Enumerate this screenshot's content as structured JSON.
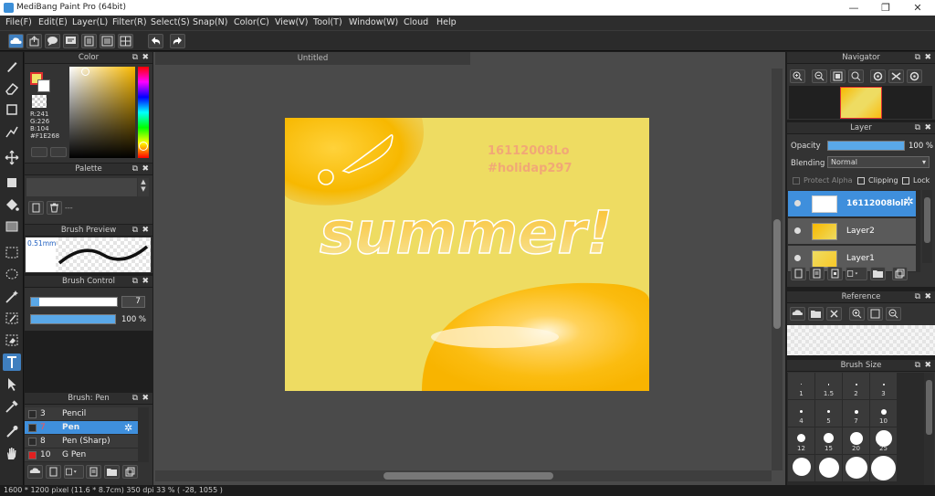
{
  "window": {
    "title": "MediBang Paint Pro (64bit)",
    "min": "—",
    "max": "❐",
    "close": "✕"
  },
  "menu": [
    "File(F)",
    "Edit(E)",
    "Layer(L)",
    "Filter(R)",
    "Select(S)",
    "Snap(N)",
    "Color(C)",
    "View(V)",
    "Tool(T)",
    "Window(W)",
    "Cloud",
    "Help"
  ],
  "color_panel": {
    "title": "Color",
    "rgb_r": "R:241",
    "rgb_g": "G:226",
    "rgb_b": "B:104",
    "hex": "#F1E268"
  },
  "palette_panel": {
    "title": "Palette",
    "empty": "---"
  },
  "brush_preview": {
    "title": "Brush Preview",
    "size": "0.51mm"
  },
  "brush_control": {
    "title": "Brush Control",
    "size_value": "7",
    "opacity_value": "100 %",
    "size_fill": 0.1,
    "opacity_fill": 1.0
  },
  "brush_list": {
    "title": "Brush: Pen",
    "items": [
      {
        "num": "3",
        "name": "Pencil",
        "color": "#2a2a2a"
      },
      {
        "num": "7",
        "name": "Pen",
        "color": "#2a2a2a"
      },
      {
        "num": "8",
        "name": "Pen (Sharp)",
        "color": "#2a2a2a"
      },
      {
        "num": "10",
        "name": "G Pen",
        "color": "#e02020"
      }
    ]
  },
  "document": {
    "tab": "Untitled",
    "text_line1": "16112008Lo",
    "text_line2": "#holidap297",
    "word": "summer!"
  },
  "navigator": {
    "title": "Navigator"
  },
  "layer_panel": {
    "title": "Layer",
    "opacity_label": "Opacity",
    "opacity_value": "100 %",
    "opacity_fill": 1.0,
    "blending_label": "Blending",
    "blending_value": "Normal",
    "protect_alpha": "Protect Alpha",
    "clipping": "Clipping",
    "lock": "Lock",
    "layers": [
      {
        "name": "16112008loli",
        "active": true
      },
      {
        "name": "Layer2",
        "active": false
      },
      {
        "name": "Layer1",
        "active": false
      }
    ]
  },
  "reference_panel": {
    "title": "Reference"
  },
  "brush_size_panel": {
    "title": "Brush Size",
    "sizes": [
      "1",
      "1.5",
      "2",
      "3",
      "4",
      "5",
      "7",
      "10",
      "12",
      "15",
      "20",
      "25"
    ]
  },
  "status": "1600 * 1200 pixel   (11.6 * 8.7cm)   350 dpi   33 %   ( -28, 1055 )"
}
